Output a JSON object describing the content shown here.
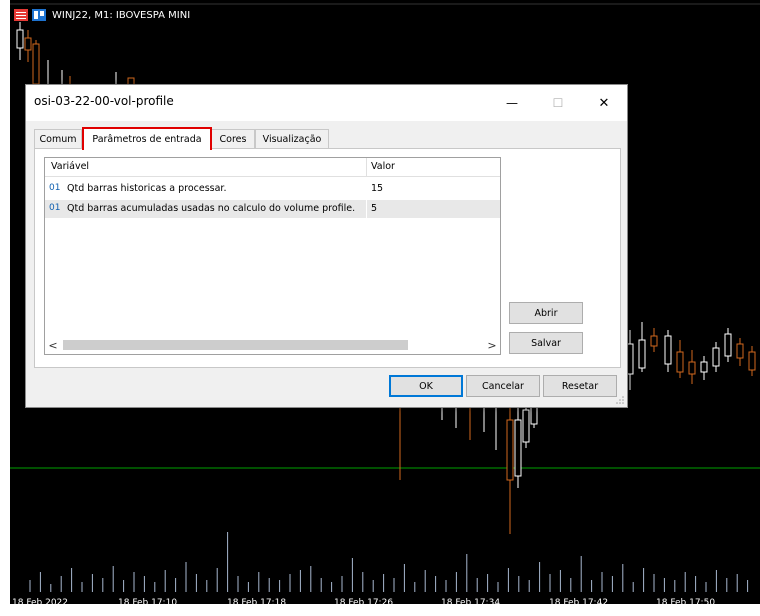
{
  "chart": {
    "title": "WINJ22, M1:  IBOVESPA MINI",
    "x_ticks": [
      "18 Feb 2022",
      "18 Feb 17:10",
      "18 Feb 17:18",
      "18 Feb 17:26",
      "18 Feb 17:34",
      "18 Feb 17:42",
      "18 Feb 17:50"
    ],
    "colors": {
      "background": "#000000",
      "bull": "#ffffff",
      "bear": "#d2691e",
      "volume": "#a8b8d0",
      "level_line": "#00a000"
    }
  },
  "dialog": {
    "title": "osi-03-22-00-vol-profile",
    "window_buttons": {
      "minimize": "—",
      "maximize": "☐",
      "close": "✕"
    },
    "tabs": [
      {
        "label": "Comum",
        "active": false
      },
      {
        "label": "Parâmetros de entrada",
        "active": true
      },
      {
        "label": "Cores",
        "active": false
      },
      {
        "label": "Visualização",
        "active": false
      }
    ],
    "params": {
      "col_variable": "Variável",
      "col_value": "Valor",
      "rows": [
        {
          "type": "01",
          "name": "Qtd barras historicas a processar.",
          "value": "15",
          "selected": false
        },
        {
          "type": "01",
          "name": "Qtd barras acumuladas usadas no calculo do volume profile.",
          "value": "5",
          "selected": true
        }
      ]
    },
    "scroll": {
      "left": "<",
      "right": ">"
    },
    "side_buttons": {
      "open": "Abrir",
      "save": "Salvar"
    },
    "footer_buttons": {
      "ok": "OK",
      "cancel": "Cancelar",
      "reset": "Resetar"
    },
    "highlight_color": "#e00000"
  }
}
